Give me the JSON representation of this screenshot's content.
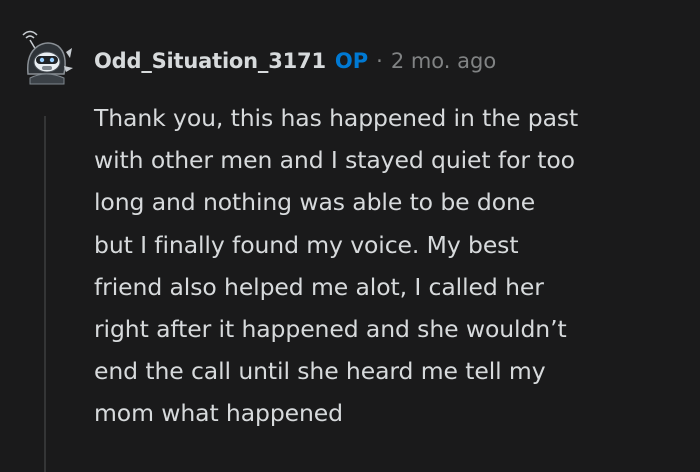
{
  "comment": {
    "author": "Odd_Situation_3171",
    "op_badge": "OP",
    "separator": "·",
    "timestamp": "2 mo. ago",
    "avatar_icon": "snoo-robot-avatar-icon",
    "body_lines": [
      "Thank you, this has happened in the past",
      "with other men and I stayed quiet for too",
      "long and nothing was able to be done",
      "but I finally found my voice. My best",
      "friend also helped me alot, I called her",
      "right after it happened and she wouldn’t",
      "end the call until she heard me tell my",
      "mom what happened"
    ]
  },
  "colors": {
    "background": "#1a1a1b",
    "text": "#d7dadc",
    "muted": "#818384",
    "op_blue": "#0079d3",
    "thread_line": "#343536"
  }
}
